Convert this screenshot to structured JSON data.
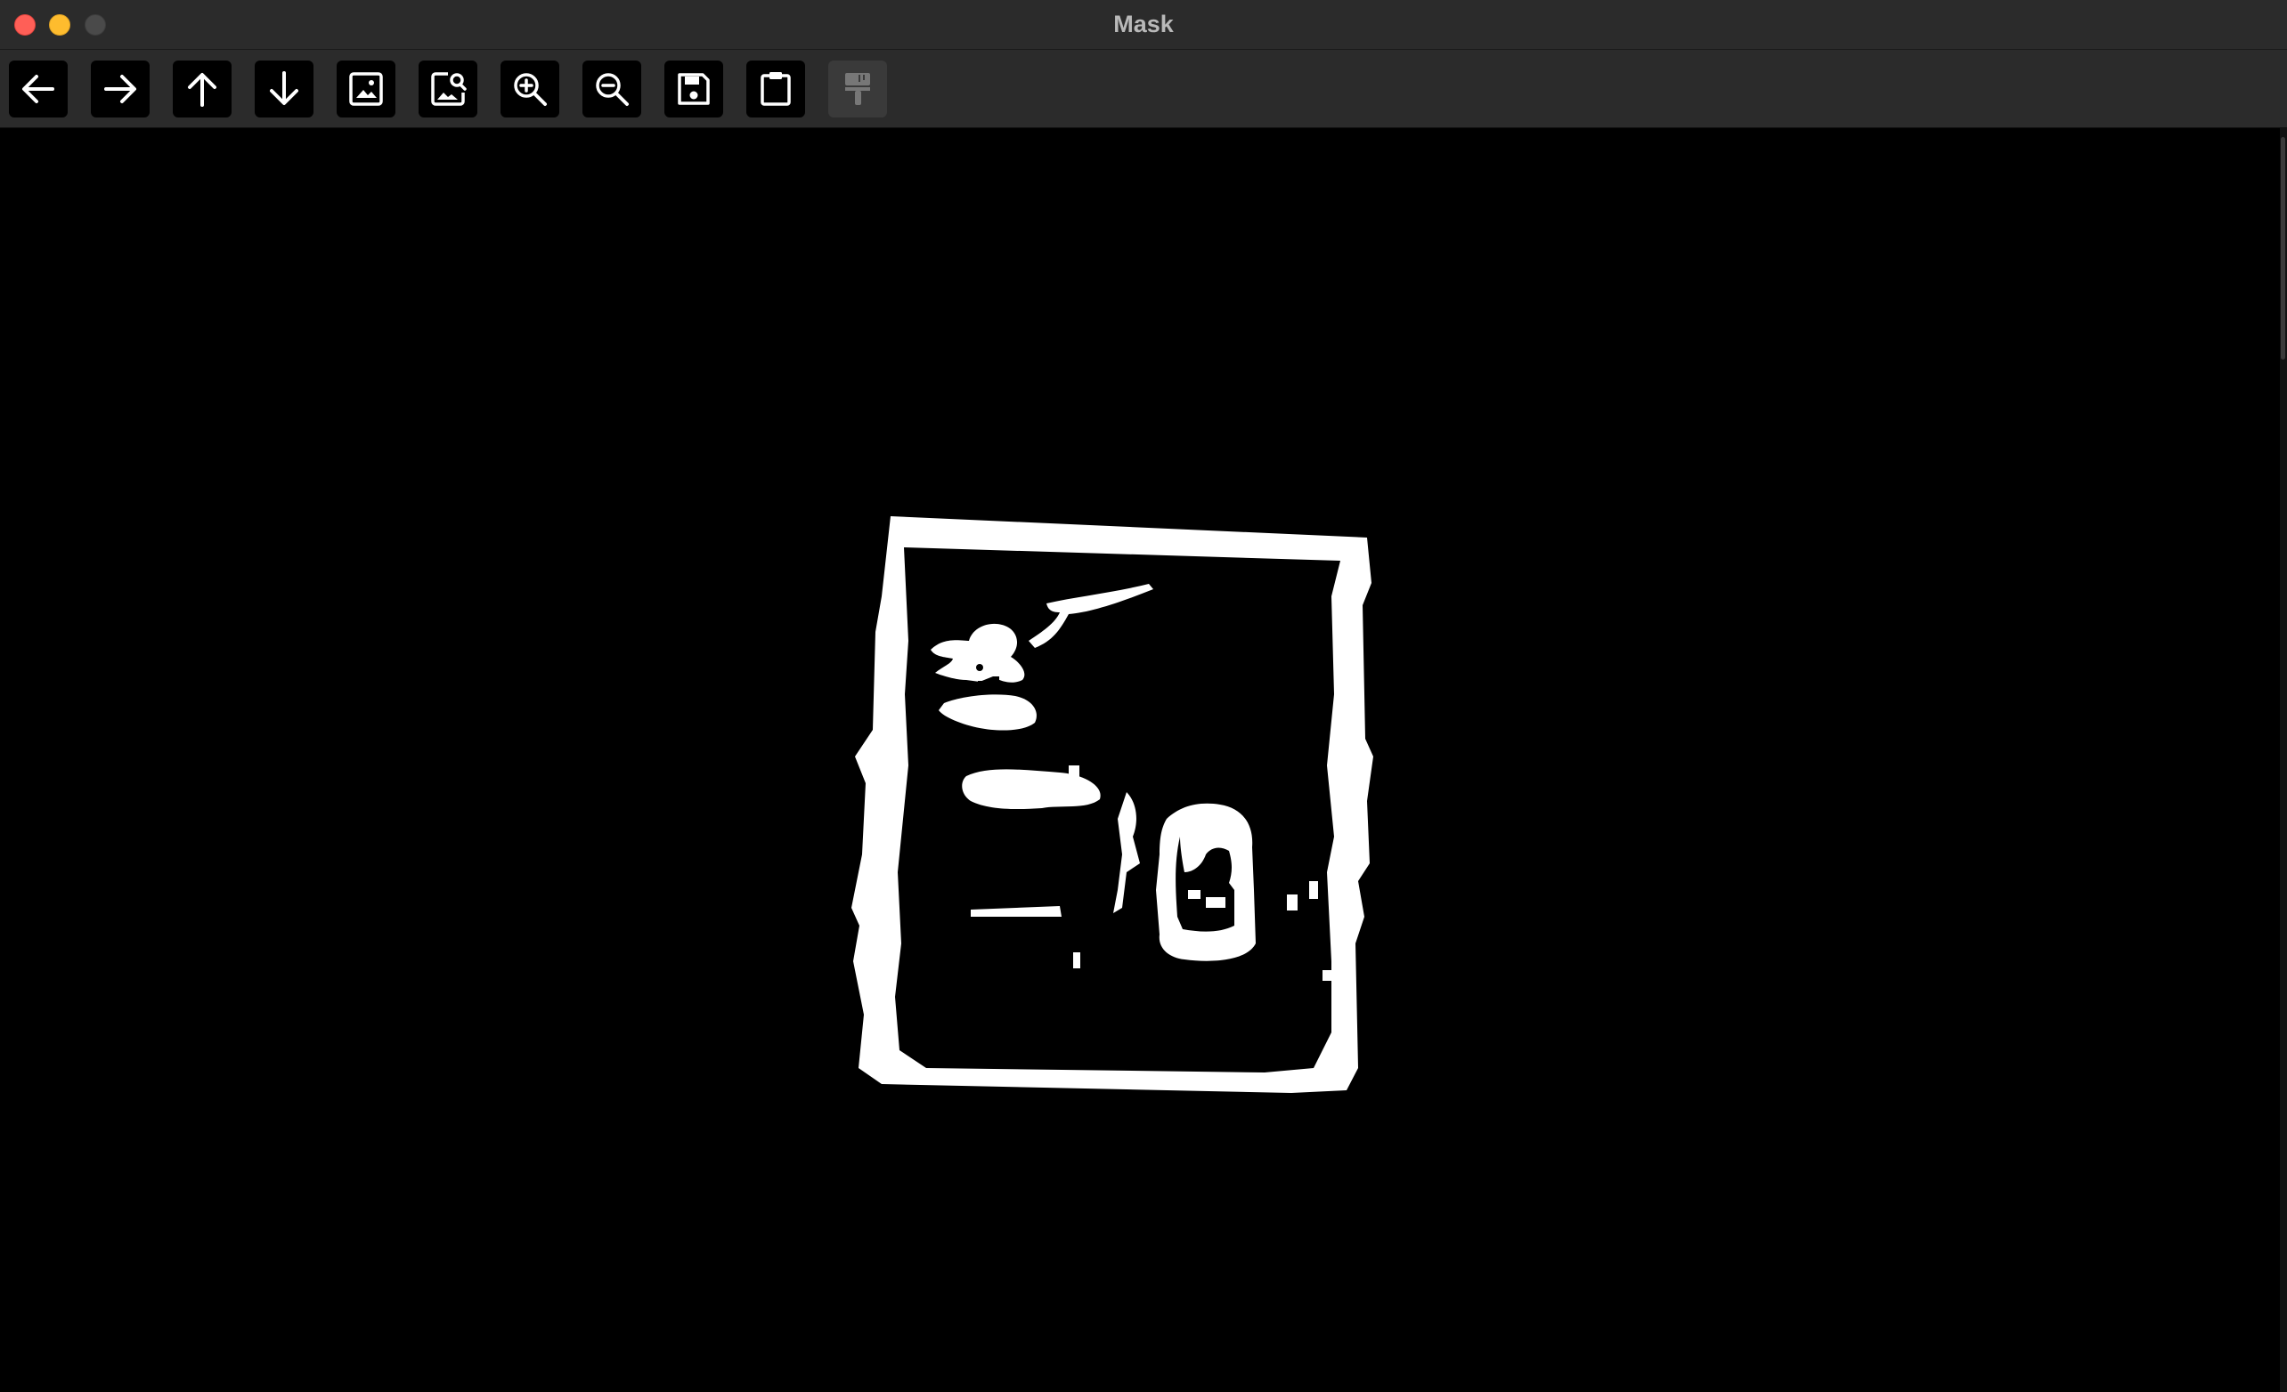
{
  "window": {
    "title": "Mask"
  },
  "toolbar": {
    "buttons": [
      {
        "name": "back-button",
        "icon": "arrow-left-icon",
        "enabled": true
      },
      {
        "name": "forward-button",
        "icon": "arrow-right-icon",
        "enabled": true
      },
      {
        "name": "up-button",
        "icon": "arrow-up-icon",
        "enabled": true
      },
      {
        "name": "down-button",
        "icon": "arrow-down-icon",
        "enabled": true
      },
      {
        "name": "image-button",
        "icon": "image-icon",
        "enabled": true
      },
      {
        "name": "image-search-button",
        "icon": "image-search-icon",
        "enabled": true
      },
      {
        "name": "zoom-in-button",
        "icon": "zoom-in-icon",
        "enabled": true
      },
      {
        "name": "zoom-out-button",
        "icon": "zoom-out-icon",
        "enabled": true
      },
      {
        "name": "save-button",
        "icon": "floppy-disk-icon",
        "enabled": true
      },
      {
        "name": "clipboard-button",
        "icon": "clipboard-icon",
        "enabled": true
      },
      {
        "name": "paint-brush-button",
        "icon": "paint-brush-icon",
        "enabled": false
      }
    ]
  },
  "canvas": {
    "background_color": "#000000",
    "mask_color": "#ffffff",
    "content": "binary-mask-image"
  }
}
